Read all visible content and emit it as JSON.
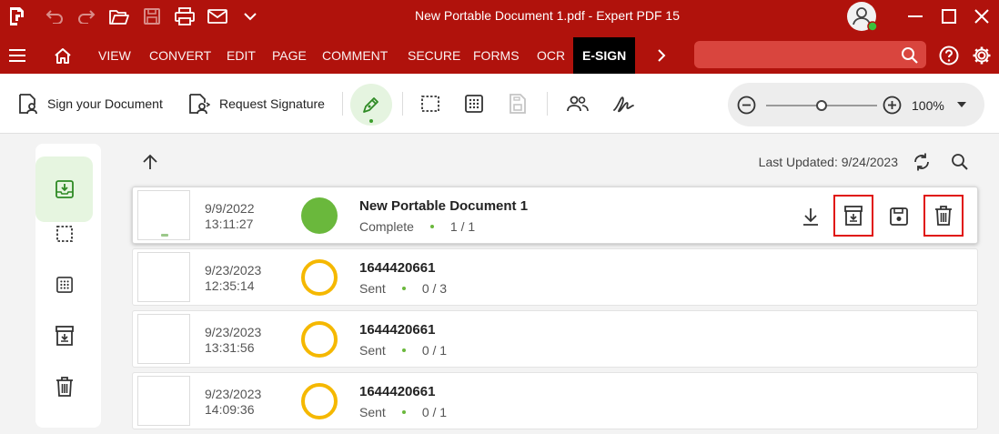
{
  "app": {
    "title": "New Portable Document 1.pdf  -  Expert PDF 15",
    "brand_color": "#b0120c"
  },
  "ribbon": {
    "tabs": [
      {
        "label": "VIEW"
      },
      {
        "label": "CONVERT"
      },
      {
        "label": "EDIT"
      },
      {
        "label": "PAGE"
      },
      {
        "label": "COMMENT"
      },
      {
        "label": "SECURE"
      },
      {
        "label": "FORMS"
      },
      {
        "label": "OCR"
      },
      {
        "label": "E-SIGN",
        "active": true
      }
    ],
    "search_placeholder": ""
  },
  "toolbar": {
    "sign_label": "Sign your Document",
    "request_label": "Request Signature",
    "zoom": "100%"
  },
  "content": {
    "last_updated": "Last Updated: 9/24/2023"
  },
  "rows": [
    {
      "date": "9/9/2022",
      "time": "13:11:27",
      "name": "New Portable Document 1",
      "status": "Complete",
      "pages": "1 / 1",
      "state": "complete"
    },
    {
      "date": "9/23/2023",
      "time": "12:35:14",
      "name": "1644420661",
      "status": "Sent",
      "pages": "0 / 3",
      "state": "sent"
    },
    {
      "date": "9/23/2023",
      "time": "13:31:56",
      "name": "1644420661",
      "status": "Sent",
      "pages": "0 / 1",
      "state": "sent"
    },
    {
      "date": "9/23/2023",
      "time": "14:09:36",
      "name": "1644420661",
      "status": "Sent",
      "pages": "0 / 1",
      "state": "sent"
    }
  ]
}
